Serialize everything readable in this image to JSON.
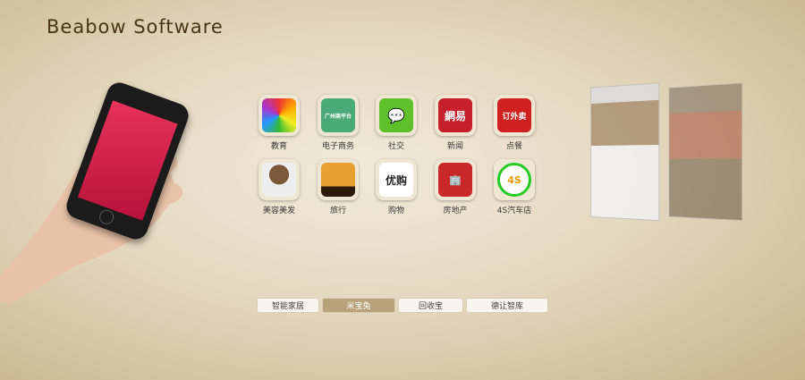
{
  "brand": "Beabow Software",
  "apps": [
    {
      "label": "教育",
      "icon": "education-icon",
      "color": "#8a8a8a"
    },
    {
      "label": "电子商务",
      "icon": "ecommerce-icon",
      "color": "#4aaa78",
      "text": "广州商平台"
    },
    {
      "label": "社交",
      "icon": "chat-icon",
      "color": "#5ec02a"
    },
    {
      "label": "新闻",
      "icon": "news-icon",
      "color": "#c8202a",
      "text": "網易"
    },
    {
      "label": "点餐",
      "icon": "order-food-icon",
      "color": "#d02020",
      "text": "订外卖"
    },
    {
      "label": "美容美发",
      "icon": "hairdressing-icon",
      "color": "#e8e2da"
    },
    {
      "label": "旅行",
      "icon": "travel-icon",
      "color": "#d89020"
    },
    {
      "label": "购物",
      "icon": "shopping-icon",
      "color": "#ffffff",
      "text": "优购"
    },
    {
      "label": "房地产",
      "icon": "real-estate-icon",
      "color": "#c82828"
    },
    {
      "label": "4S汽车店",
      "icon": "car-dealer-icon",
      "color": "#ffffff",
      "text": "4S"
    }
  ],
  "tabs": [
    {
      "label": "智能家居",
      "active": false
    },
    {
      "label": "米宝兔",
      "active": true
    },
    {
      "label": "回收宝",
      "active": false
    },
    {
      "label": "德让智库",
      "active": false
    }
  ]
}
